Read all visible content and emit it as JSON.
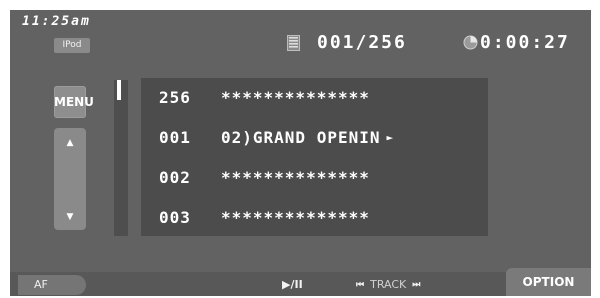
{
  "status": {
    "clock": "11:25am",
    "source": "IPod"
  },
  "header": {
    "track_counter": "001/256",
    "elapsed_time": "0:00:27"
  },
  "controls": {
    "menu_label": "MENU",
    "up_arrow": "▲",
    "down_arrow": "▼"
  },
  "tracks": [
    {
      "number": "256",
      "title": "**************",
      "selected": false
    },
    {
      "number": "001",
      "title": "02)GRAND OPENIN",
      "selected": true
    },
    {
      "number": "002",
      "title": "**************",
      "selected": false
    },
    {
      "number": "003",
      "title": "**************",
      "selected": false
    }
  ],
  "bottom_bar": {
    "af_label": "AF",
    "play_pause_label": "▶/II",
    "track_prev_icon": "⏮",
    "track_label": "TRACK",
    "track_next_icon": "⏭",
    "option_label": "OPTION"
  },
  "icons": {
    "disc": "disc-icon",
    "clock": "clock-icon",
    "selected_marker": "play-triangle-icon"
  },
  "colors": {
    "screen_bg": "#626262",
    "list_bg": "#4c4c4c",
    "text": "#ffffff",
    "button_bg": "#8e8e8e"
  }
}
